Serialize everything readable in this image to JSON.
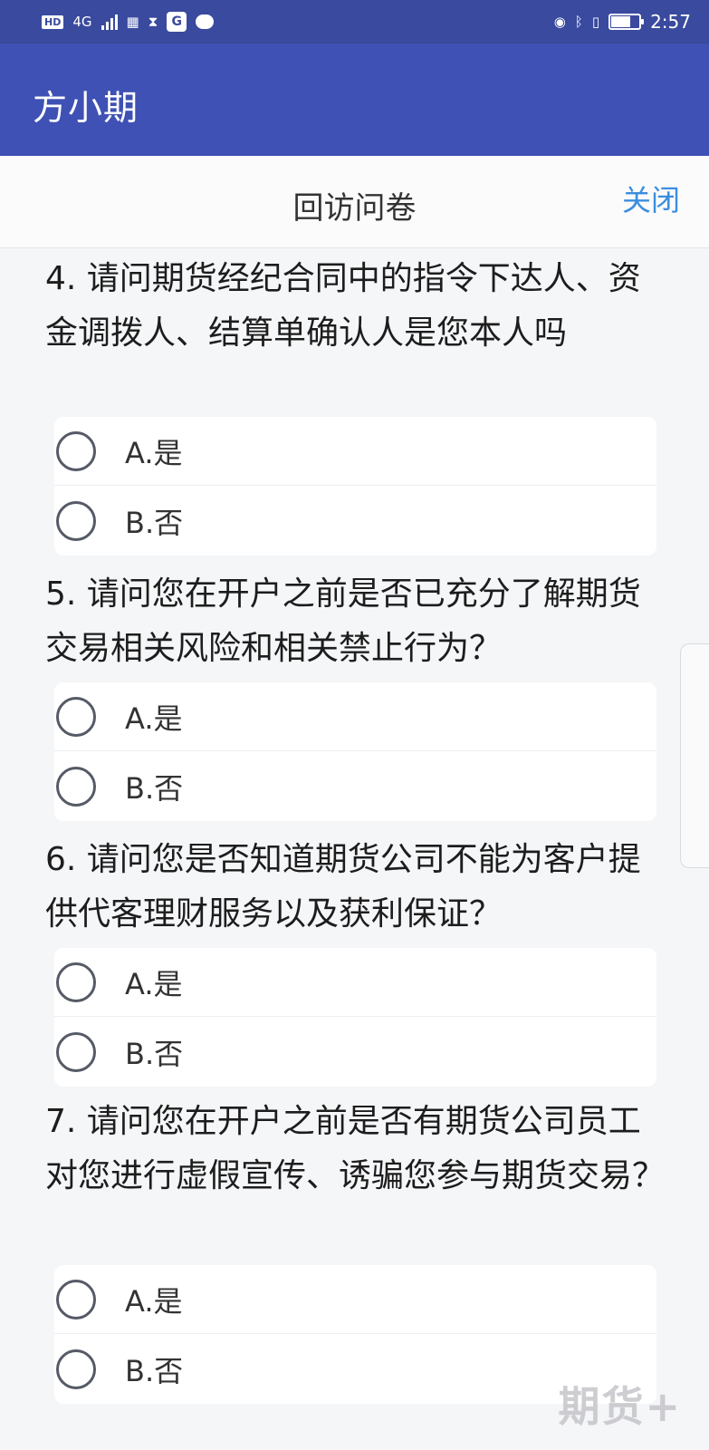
{
  "status_bar": {
    "network": "4G",
    "time": "2:57",
    "battery_level": 0.7
  },
  "app": {
    "title": "方小期"
  },
  "dialog": {
    "title": "回访问卷",
    "close_label": "关闭"
  },
  "questions": [
    {
      "text": "4. 请问期货经纪合同中的指令下达人、资金调拨人、结算单确认人是您本人吗",
      "options": [
        "A.是",
        "B.否"
      ]
    },
    {
      "text": "5. 请问您在开户之前是否已充分了解期货交易相关风险和相关禁止行为？",
      "options": [
        "A.是",
        "B.否"
      ]
    },
    {
      "text": "6. 请问您是否知道期货公司不能为客户提供代客理财服务以及获利保证？",
      "options": [
        "A.是",
        "B.否"
      ]
    },
    {
      "text": "7. 请问您在开户之前是否有期货公司员工对您进行虚假宣传、诱骗您参与期货交易？",
      "options": [
        "A.是",
        "B.否"
      ]
    }
  ],
  "watermark": "期货+"
}
